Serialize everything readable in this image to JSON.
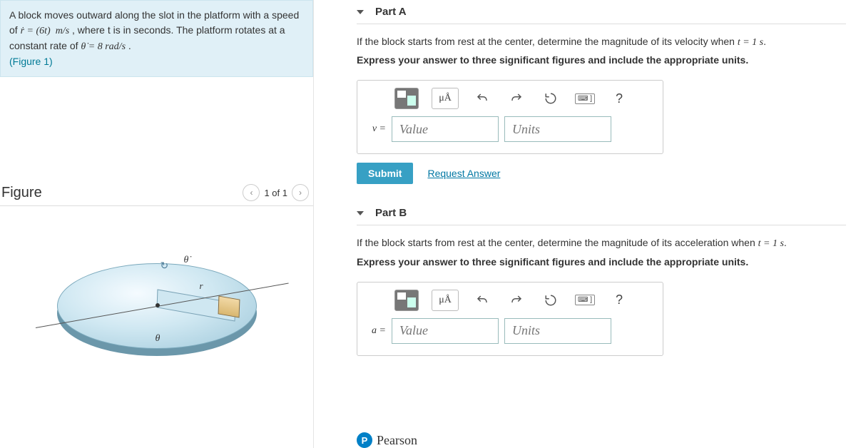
{
  "problem": {
    "text_segments": {
      "s1": "A block moves outward along the slot in the platform with a speed of ",
      "rdot": "ṙ = (6t)  m/s",
      "s2": ", where t is in seconds. The platform rotates at a constant rate of ",
      "thetadot": "θ̇ = 8 rad/s",
      "s3": " .",
      "figref": "(Figure 1)"
    }
  },
  "figure": {
    "heading": "Figure",
    "nav_label": "1 of 1",
    "labels": {
      "theta_dot": "θ̇",
      "theta": "θ",
      "r": "r"
    }
  },
  "parts": [
    {
      "title": "Part A",
      "prompt": "If the block starts from rest at the center, determine the magnitude of its velocity when ",
      "cond": "t = 1 s",
      "prompt_tail": ".",
      "instr": "Express your answer to three significant figures and include the appropriate units.",
      "var": "v =",
      "value_ph": "Value",
      "units_ph": "Units",
      "submit": "Submit",
      "request": "Request Answer",
      "ua": "μÅ",
      "kbd": "⌨ ]",
      "help": "?"
    },
    {
      "title": "Part B",
      "prompt": "If the block starts from rest at the center, determine the magnitude of its acceleration when ",
      "cond": "t = 1 s",
      "prompt_tail": ".",
      "instr": "Express your answer to three significant figures and include the appropriate units.",
      "var": "a =",
      "value_ph": "Value",
      "units_ph": "Units",
      "ua": "μÅ",
      "kbd": "⌨ ]",
      "help": "?"
    }
  ],
  "brand": "Pearson"
}
